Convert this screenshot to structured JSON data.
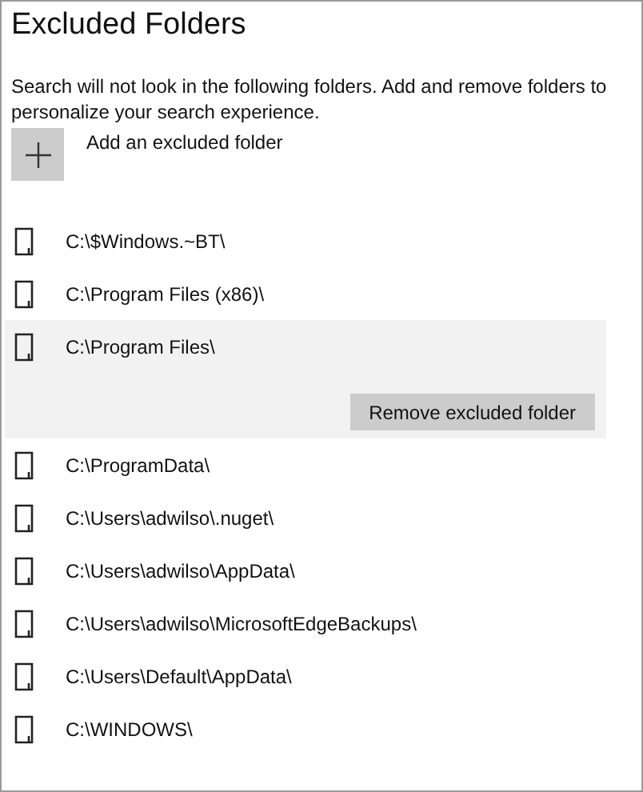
{
  "title": "Excluded Folders",
  "description": "Search will not look in the following folders. Add and remove folders to personalize your search experience.",
  "add_button": {
    "label": "Add an excluded folder"
  },
  "folders": [
    {
      "path": "C:\\$Windows.~BT\\",
      "selected": false
    },
    {
      "path": "C:\\Program Files (x86)\\",
      "selected": false
    },
    {
      "path": "C:\\Program Files\\",
      "selected": true,
      "action": "Remove excluded folder"
    },
    {
      "path": "C:\\ProgramData\\",
      "selected": false
    },
    {
      "path": "C:\\Users\\adwilso\\.nuget\\",
      "selected": false
    },
    {
      "path": "C:\\Users\\adwilso\\AppData\\",
      "selected": false
    },
    {
      "path": "C:\\Users\\adwilso\\MicrosoftEdgeBackups\\",
      "selected": false
    },
    {
      "path": "C:\\Users\\Default\\AppData\\",
      "selected": false
    },
    {
      "path": "C:\\WINDOWS\\",
      "selected": false
    }
  ]
}
